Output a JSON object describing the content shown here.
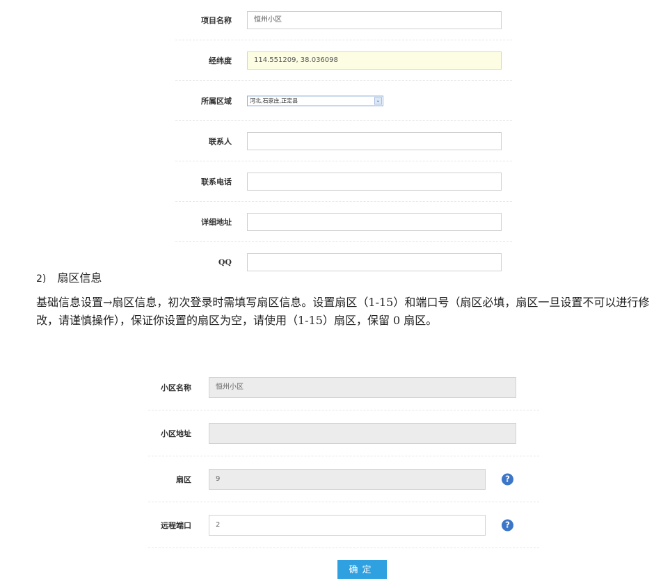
{
  "top_form": {
    "project_name_label": "项目名称",
    "project_name_value": "恒州小区",
    "latlng_label": "经纬度",
    "latlng_value": "114.551209,  38.036098",
    "region_label": "所属区域",
    "region_value": "河北,石家庄,正定县",
    "contact_label": "联系人",
    "contact_value": "",
    "phone_label": "联系电话",
    "phone_value": "",
    "address_label": "详细地址",
    "address_value": "",
    "qq_label": "QQ",
    "qq_value": ""
  },
  "section": {
    "number": "2)",
    "title": "扇区信息",
    "description": "基础信息设置→扇区信息，初次登录时需填写扇区信息。设置扇区（1-15）和端口号（扇区必填，扇区一旦设置不可以进行修改，请谨慎操作），保证你设置的扇区为空，请使用（1-15）扇区，保留 0 扇区。"
  },
  "bottom_form": {
    "community_name_label": "小区名称",
    "community_name_value": "恒州小区",
    "community_address_label": "小区地址",
    "community_address_value": "",
    "sector_label": "扇区",
    "sector_value": "9",
    "port_label": "远程端口",
    "port_value": "2",
    "help_icon_glyph": "?",
    "submit_label": "确定"
  },
  "colors": {
    "accent": "#2fa0e0",
    "help_icon": "#3c76c8"
  }
}
